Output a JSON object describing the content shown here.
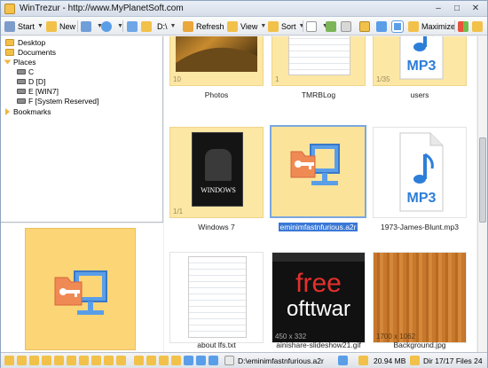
{
  "window": {
    "title": "WinTrezur - http://www.MyPlanetSoft.com",
    "controls": [
      "–",
      "□",
      "✕"
    ]
  },
  "toolbar": {
    "start_label": "Start",
    "new_label": "New",
    "path_label": "D:\\",
    "refresh_label": "Refresh",
    "view_label": "View",
    "sort_label": "Sort",
    "maximize_label": "Maximize"
  },
  "tree": {
    "items": [
      {
        "label": "Desktop",
        "kind": "folder"
      },
      {
        "label": "Documents",
        "kind": "folder"
      },
      {
        "label": "Places",
        "kind": "group"
      },
      {
        "label": "C",
        "kind": "drive"
      },
      {
        "label": "D [D]",
        "kind": "drive"
      },
      {
        "label": "E [WIN7]",
        "kind": "drive"
      },
      {
        "label": "F [System Reserved]",
        "kind": "drive"
      },
      {
        "label": "Bookmarks",
        "kind": "group"
      }
    ]
  },
  "thumbs": [
    {
      "name": "Photos",
      "badge": "10",
      "kind": "photo"
    },
    {
      "name": "TMRBLog",
      "badge": "1",
      "kind": "doc"
    },
    {
      "name": "users",
      "badge": "1/35",
      "kind": "mp3"
    },
    {
      "name": "Windows 7",
      "badge": "1/1",
      "kind": "poster",
      "poster_title": "WINDOWS"
    },
    {
      "name": "eminimfastnfurious.a2r",
      "kind": "key",
      "selected": true
    },
    {
      "name": "1973-James-Blunt.mp3",
      "kind": "mp3"
    },
    {
      "name": "about lfs.txt",
      "kind": "txt"
    },
    {
      "name": "ainishare-slideshow21.gif",
      "dims": "450 x 332",
      "kind": "free",
      "poster_text_1": "free",
      "poster_text_2": "ofttwar"
    },
    {
      "name": "Background.jpg",
      "dims": "1700 x 1062",
      "kind": "wood"
    }
  ],
  "mp3_text": "MP3",
  "status": {
    "path": "D:\\eminimfastnfurious.a2r",
    "size": "20.94 MB",
    "counts": "Dir 17/17 Files 24"
  },
  "colors": {
    "folder_yellow": "#fde7a4",
    "selection_blue": "#3a78d6",
    "key_orange": "#f08a55",
    "monitor_blue": "#5a9ee8"
  }
}
